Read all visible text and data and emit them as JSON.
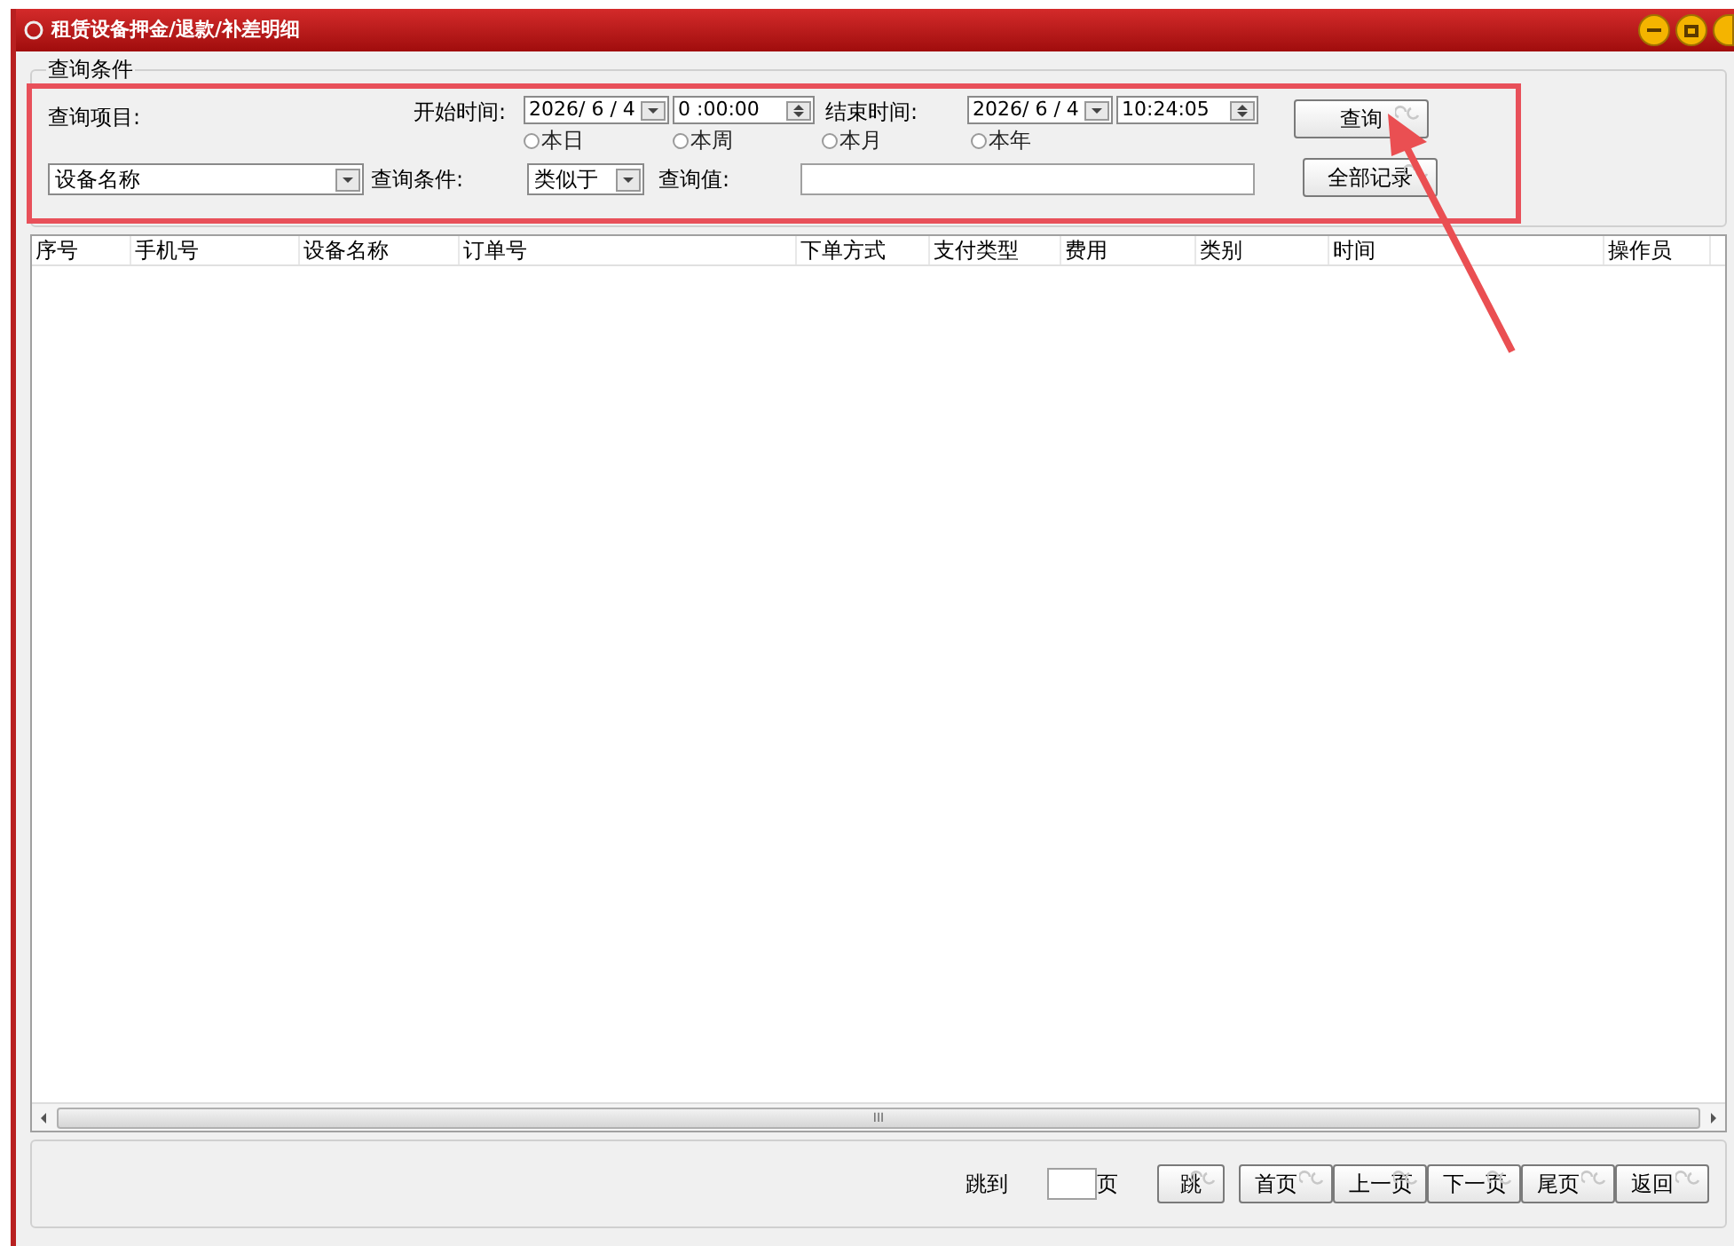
{
  "window": {
    "title": "租赁设备押金/退款/补差明细"
  },
  "query": {
    "group_title": "查询条件",
    "item_label": "查询项目:",
    "item_value": "设备名称",
    "start_label": "开始时间:",
    "start_date": "2026/ 6 / 4",
    "start_time": "0 :00:00",
    "end_label": "结束时间:",
    "end_date": "2026/ 6 / 4",
    "end_time": "10:24:05",
    "ranges": [
      {
        "label": "本日",
        "selected": false
      },
      {
        "label": "本周",
        "selected": false
      },
      {
        "label": "本月",
        "selected": false
      },
      {
        "label": "本年",
        "selected": false
      }
    ],
    "condition_label": "查询条件:",
    "condition_value": "类似于",
    "value_label": "查询值:",
    "search_button": "查询",
    "all_button": "全部记录"
  },
  "table": {
    "columns": [
      "序号",
      "手机号",
      "设备名称",
      "订单号",
      "下单方式",
      "支付类型",
      "费用",
      "类别",
      "时间",
      "操作员"
    ]
  },
  "scrollbar_label": "III",
  "pager": {
    "jump_label": "跳到",
    "page_unit": "页",
    "jump_button": "跳",
    "buttons": [
      "首页",
      "上一页",
      "下一页",
      "尾页",
      "返回"
    ]
  }
}
